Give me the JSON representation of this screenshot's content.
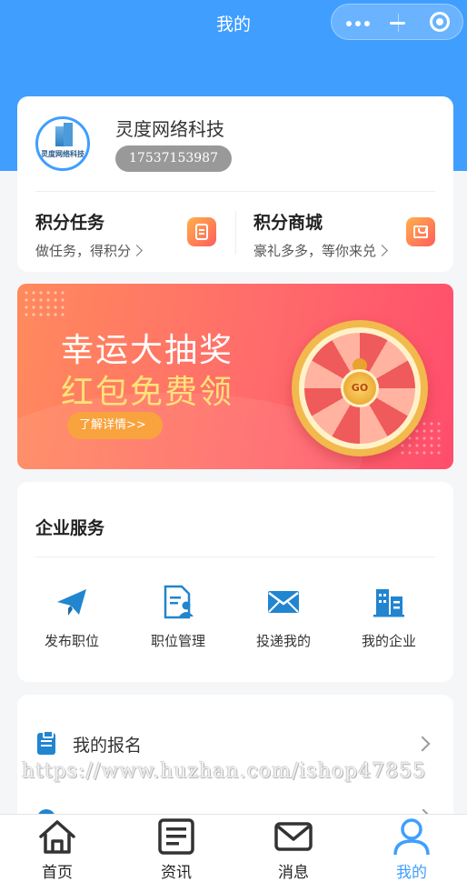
{
  "nav": {
    "title": "我的"
  },
  "profile": {
    "company_name": "灵度网络科技",
    "phone": "17537153987",
    "avatar_text": "灵度网络科技"
  },
  "points": [
    {
      "title": "积分任务",
      "subtitle": "做任务，得积分"
    },
    {
      "title": "积分商城",
      "subtitle": "豪礼多多，等你来兑"
    }
  ],
  "banner": {
    "line1": "幸运大抽奖",
    "line2": "红包免费领",
    "button": "了解详情>>",
    "wheel_label": "GO"
  },
  "services": {
    "title": "企业服务",
    "items": [
      {
        "label": "发布职位",
        "icon": "paper-plane-icon"
      },
      {
        "label": "职位管理",
        "icon": "document-user-icon"
      },
      {
        "label": "投递我的",
        "icon": "envelope-icon"
      },
      {
        "label": "我的企业",
        "icon": "building-icon"
      }
    ]
  },
  "list": {
    "items": [
      {
        "label": "我的报名",
        "icon": "clipboard-icon"
      }
    ]
  },
  "watermark": "https://www.huzhan.com/ishop47855",
  "tabbar": {
    "items": [
      {
        "label": "首页",
        "icon": "home-icon",
        "active": false
      },
      {
        "label": "资讯",
        "icon": "news-icon",
        "active": false
      },
      {
        "label": "消息",
        "icon": "mail-icon",
        "active": false
      },
      {
        "label": "我的",
        "icon": "user-icon",
        "active": true
      }
    ]
  },
  "colors": {
    "primary": "#409eff",
    "icon_blue": "#2185d0",
    "accent_orange": "#ff8a5c"
  }
}
